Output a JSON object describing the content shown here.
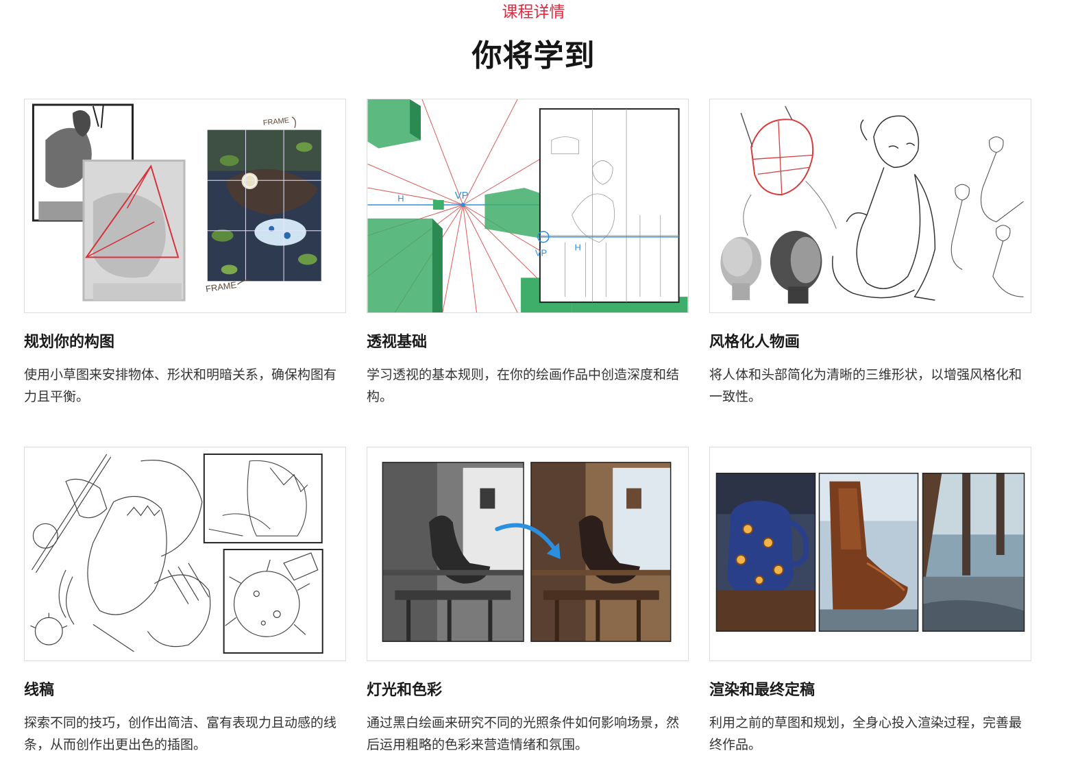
{
  "header": {
    "eyebrow": "课程详情",
    "title": "你将学到"
  },
  "colors": {
    "accent": "#e8253c",
    "perspective_green": "#3fae6a",
    "perspective_red": "#d84848",
    "perspective_blue": "#2b8fe0"
  },
  "cards": [
    {
      "title": "规划你的构图",
      "description": "使用小草图来安排物体、形状和明暗关系，确保构图有力且平衡。",
      "image_labels": [
        "FRAME",
        "FRAME"
      ]
    },
    {
      "title": "透视基础",
      "description": "学习透视的基本规则，在你的绘画作品中创造深度和结构。",
      "image_labels": [
        "H",
        "VP",
        "VP",
        "H"
      ]
    },
    {
      "title": "风格化人物画",
      "description": "将人体和头部简化为清晰的三维形状，以增强风格化和一致性。"
    },
    {
      "title": "线稿",
      "description": "探索不同的技巧，创作出简洁、富有表现力且动感的线条，从而创作出更出色的插图。"
    },
    {
      "title": "灯光和色彩",
      "description": "通过黑白绘画来研究不同的光照条件如何影响场景，然后运用粗略的色彩来营造情绪和氛围。"
    },
    {
      "title": "渲染和最终定稿",
      "description": "利用之前的草图和规划，全身心投入渲染过程，完善最终作品。"
    }
  ]
}
